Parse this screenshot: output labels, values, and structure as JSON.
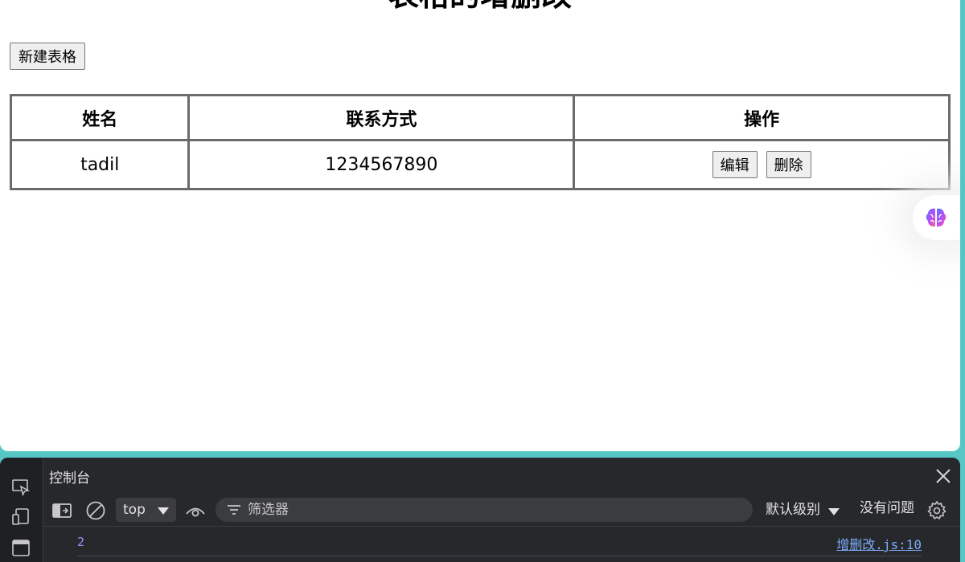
{
  "page": {
    "title": "表格的增删改",
    "new_button": "新建表格"
  },
  "table": {
    "headers": [
      "姓名",
      "联系方式",
      "操作"
    ],
    "rows": [
      {
        "name": "tadil",
        "contact": "1234567890",
        "edit": "编辑",
        "delete": "删除"
      }
    ]
  },
  "devtools": {
    "panel_title": "控制台",
    "context": "top",
    "filter_placeholder": "筛选器",
    "level": "默认级别",
    "issues": "没有问题",
    "log": {
      "value": "2",
      "source": "增删改.js:10"
    }
  },
  "colors": {
    "frame": "#57c7c5",
    "table_border": "#6b6b6b",
    "devtools_bg": "#27282c",
    "log_number": "#9a8ff5",
    "link": "#7cacf8"
  },
  "icons": [
    "brain-icon",
    "inspect-icon",
    "device-icon",
    "panel-icon",
    "close-icon",
    "sidebar-toggle-icon",
    "clear-icon",
    "eye-icon",
    "filter-icon",
    "settings-icon"
  ]
}
